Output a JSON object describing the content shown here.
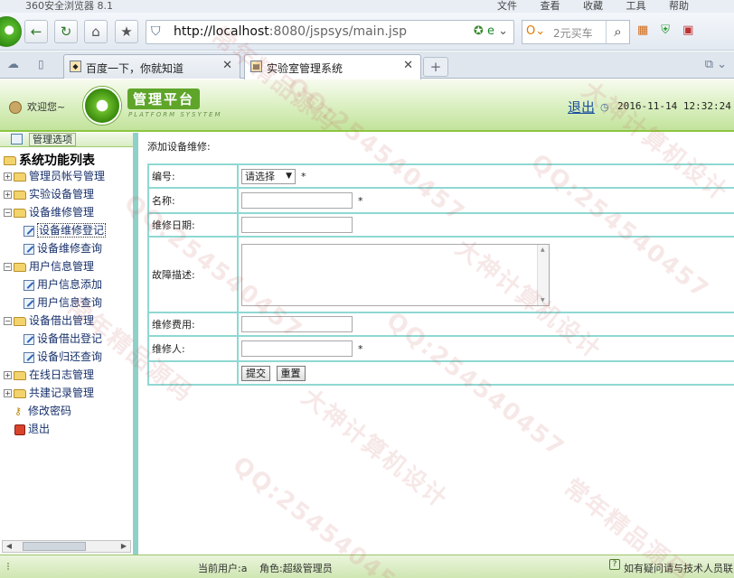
{
  "browser": {
    "title": "360安全浏览器 8.1",
    "menus": [
      "文件",
      "查看",
      "收藏",
      "工具",
      "帮助"
    ],
    "url_host": "http://localhost",
    "url_rest": ":8080/jspsys/main.jsp",
    "search_placeholder": "2元买车",
    "tabs": [
      {
        "label": "百度一下，你就知道",
        "active": false
      },
      {
        "label": "实验室管理系统",
        "active": true
      }
    ]
  },
  "header": {
    "welcome": "欢迎您~",
    "brand": "管理平台",
    "brand_sub": "PLATFORM SYSYTEM",
    "logout": "退出",
    "datetime": "2016-11-14 12:32:24"
  },
  "sidebar": {
    "header": "管理选项",
    "root": "系统功能列表",
    "nodes": [
      {
        "label": "管理员帐号管理",
        "expanded": false,
        "children": []
      },
      {
        "label": "实验设备管理",
        "expanded": false,
        "children": []
      },
      {
        "label": "设备维修管理",
        "expanded": true,
        "children": [
          "设备维修登记",
          "设备维修查询"
        ]
      },
      {
        "label": "用户信息管理",
        "expanded": true,
        "children": [
          "用户信息添加",
          "用户信息查询"
        ]
      },
      {
        "label": "设备借出管理",
        "expanded": true,
        "children": [
          "设备借出登记",
          "设备归还查询"
        ]
      },
      {
        "label": "在线日志管理",
        "expanded": false,
        "children": []
      },
      {
        "label": "共建记录管理",
        "expanded": false,
        "children": []
      }
    ],
    "extra": [
      "修改密码",
      "退出"
    ]
  },
  "form": {
    "title": "添加设备维修:",
    "id_label": "编号:",
    "id_select": "请选择",
    "name_label": "名称:",
    "date_label": "维修日期:",
    "desc_label": "故障描述:",
    "cost_label": "维修费用:",
    "person_label": "维修人:",
    "required_mark": "*",
    "submit": "提交",
    "reset": "重置"
  },
  "status": {
    "current_user": "当前用户:a",
    "role": "角色:超级管理员",
    "help": "如有疑问请与技术人员联系"
  },
  "watermark": {
    "qq": "QQ:254540457",
    "shen": "大神计算机设计",
    "chang": "常年精品源码"
  }
}
